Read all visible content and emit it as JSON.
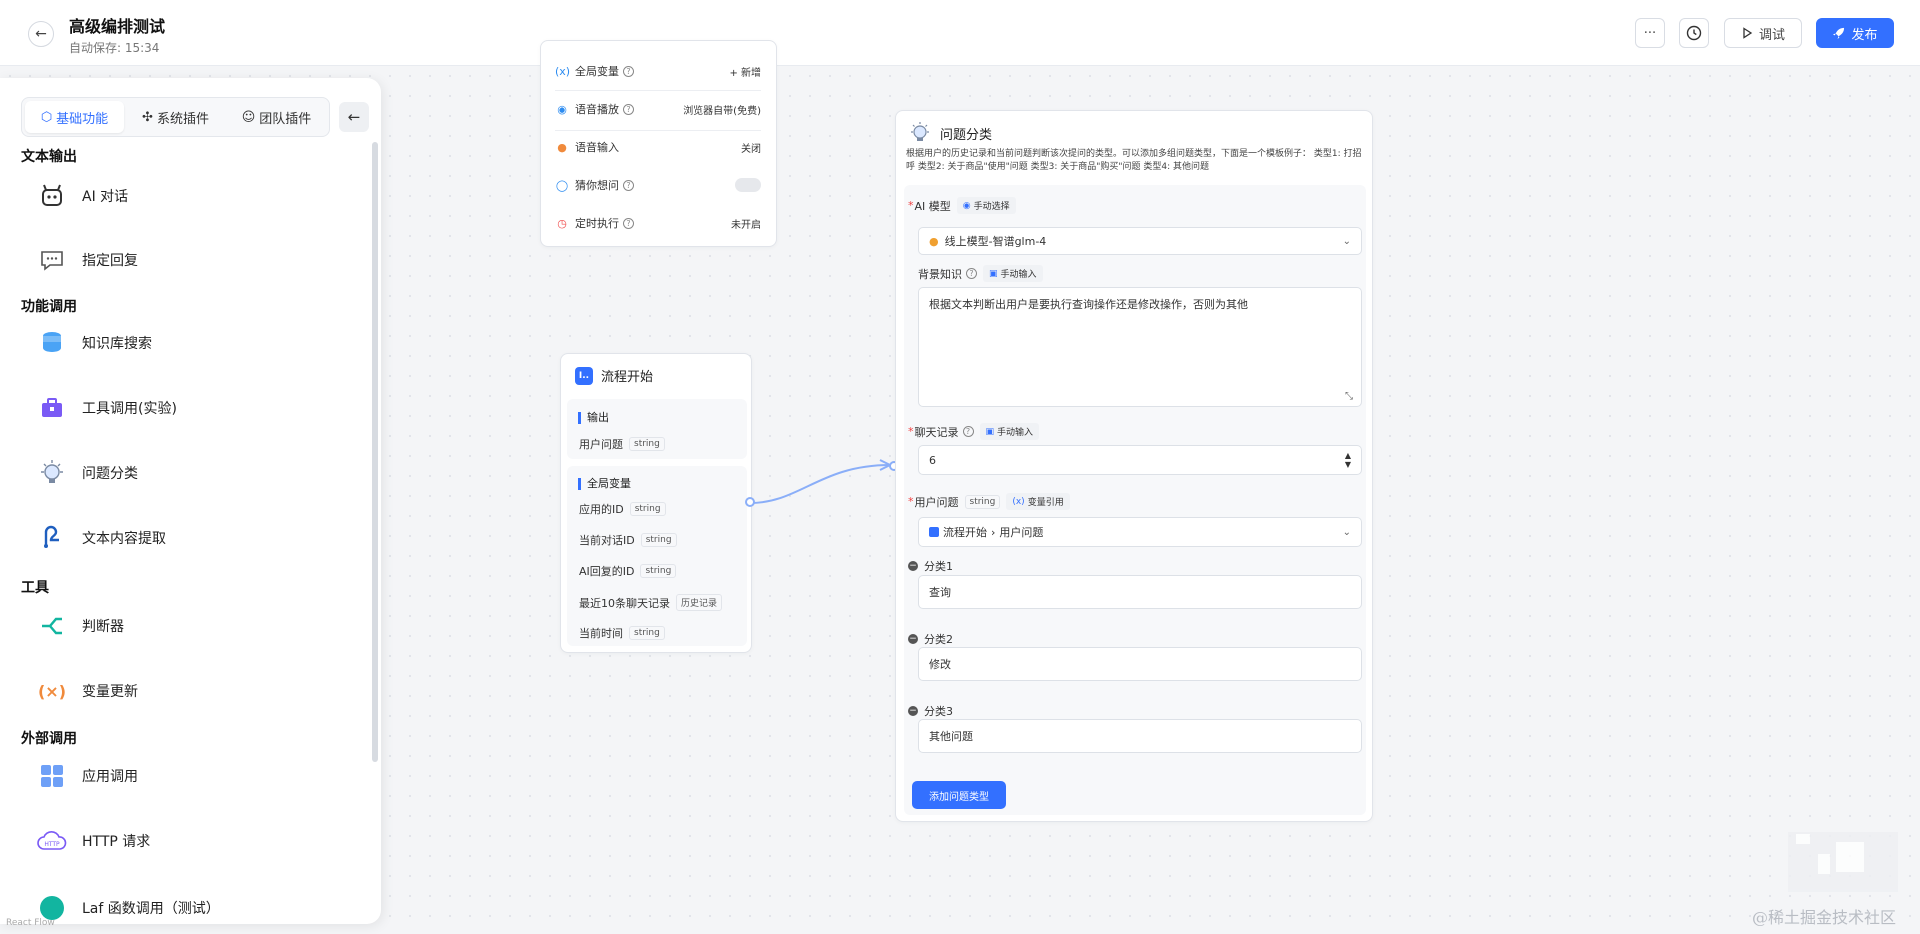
{
  "header": {
    "title": "高级编排测试",
    "autosave": "自动保存: 15:34",
    "more_label": "···",
    "debug_label": "调试",
    "publish_label": "发布"
  },
  "sidebar": {
    "tabs": [
      {
        "label": "基础功能",
        "active": true
      },
      {
        "label": "系统插件"
      },
      {
        "label": "团队插件"
      }
    ],
    "groups": [
      {
        "title": "文本输出",
        "items": [
          "AI 对话",
          "指定回复"
        ]
      },
      {
        "title": "功能调用",
        "items": [
          "知识库搜索",
          "工具调用(实验)",
          "问题分类",
          "文本内容提取"
        ]
      },
      {
        "title": "工具",
        "items": [
          "判断器",
          "变量更新"
        ]
      },
      {
        "title": "外部调用",
        "items": [
          "应用调用",
          "HTTP 请求",
          "Laf 函数调用（测试）"
        ]
      }
    ]
  },
  "system_config": {
    "rows": [
      {
        "label": "全局变量",
        "value": "+ 新增"
      },
      {
        "label": "语音播放",
        "value": "浏览器自带(免费)"
      },
      {
        "label": "语音输入",
        "value": "关闭"
      },
      {
        "label": "猜你想问",
        "value": ""
      },
      {
        "label": "定时执行",
        "value": "未开启"
      }
    ]
  },
  "start_node": {
    "title": "流程开始",
    "output_title": "输出",
    "outputs": [
      {
        "name": "用户问题",
        "type": "string"
      }
    ],
    "globals_title": "全局变量",
    "globals": [
      {
        "name": "应用的ID",
        "type": "string"
      },
      {
        "name": "当前对话ID",
        "type": "string"
      },
      {
        "name": "AI回复的ID",
        "type": "string"
      },
      {
        "name": "最近10条聊天记录",
        "type": "历史记录"
      },
      {
        "name": "当前时间",
        "type": "string"
      }
    ]
  },
  "classify_node": {
    "title": "问题分类",
    "description": "根据用户的历史记录和当前问题判断该次提问的类型。可以添加多组问题类型，下面是一个模板例子： 类型1: 打招呼 类型2: 关于商品\"使用\"问题 类型3: 关于商品\"购买\"问题 类型4: 其他问题",
    "ai_model_label": "AI 模型",
    "ai_model_chip": "手动选择",
    "ai_model_value": "线上模型-智谱glm-4",
    "background_label": "背景知识",
    "background_chip": "手动输入",
    "background_value": "根据文本判断出用户是要执行查询操作还是修改操作，否则为其他",
    "history_label": "聊天记录",
    "history_chip": "手动输入",
    "history_value": "6",
    "question_label": "用户问题",
    "question_type": "string",
    "question_chip": "变量引用",
    "question_source": "流程开始",
    "question_var": "用户问题",
    "categories": [
      {
        "label": "分类1",
        "value": "查询"
      },
      {
        "label": "分类2",
        "value": "修改"
      },
      {
        "label": "分类3",
        "value": "其他问题"
      }
    ],
    "add_button": "添加问题类型"
  },
  "canvas": {
    "footer_label": "React Flow",
    "watermark": "@稀土掘金技术社区"
  }
}
